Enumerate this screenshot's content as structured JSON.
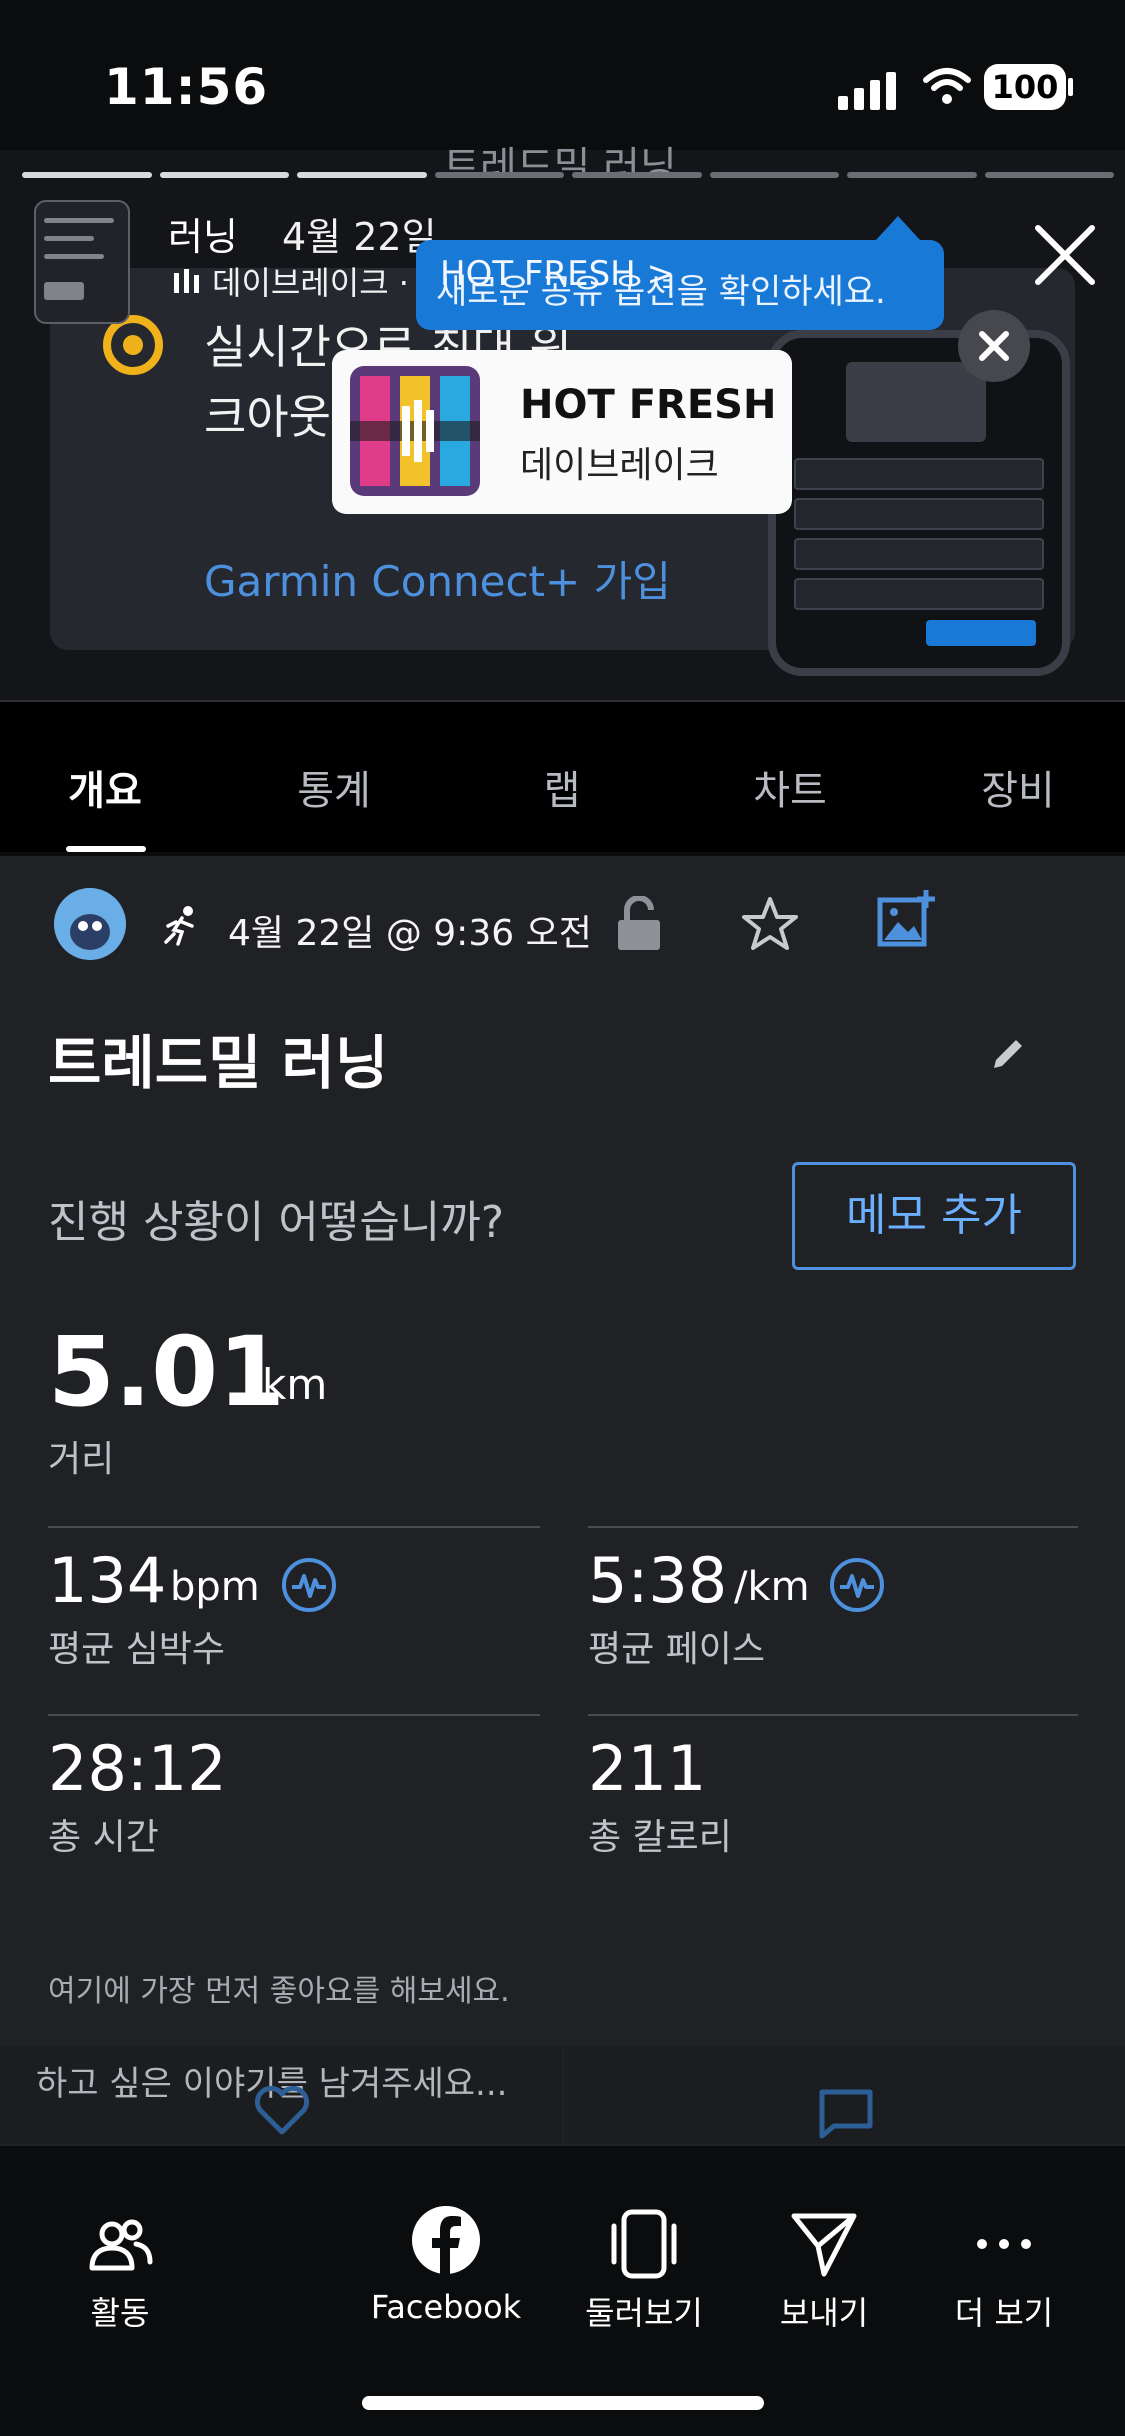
{
  "status_bar": {
    "time": "11:56",
    "battery": "100"
  },
  "story": {
    "header_ghost": "트레드밀 러닝",
    "title": "러닝",
    "date": "4월 22일",
    "artist_line": "데이브레이크 · HOT FRESH >"
  },
  "tooltip": {
    "text": "새로운 공유 옵션을 확인하세요.",
    "overlay": "HOT FRESH >"
  },
  "music": {
    "title": "HOT FRESH",
    "artist": "데이브레이크"
  },
  "promo": {
    "text": "실시간으로 최대 워크아웃 하세요",
    "link": "Garmin Connect+ 가입"
  },
  "tabs": [
    "개요",
    "통계",
    "랩",
    "차트",
    "장비"
  ],
  "activity": {
    "datetime": "4월 22일 @ 9:36 오전",
    "title": "트레드밀 러닝",
    "question": "진행 상황이 어떻습니까?",
    "memo_button": "메모 추가",
    "distance": {
      "value": "5.01",
      "unit": "km",
      "label": "거리"
    },
    "stats": [
      {
        "value": "134",
        "unit": "bpm",
        "label": "평균 심박수"
      },
      {
        "value": "5:38",
        "unit": "/km",
        "label": "평균 페이스"
      },
      {
        "value": "28:12",
        "unit": "",
        "label": "총 시간"
      },
      {
        "value": "211",
        "unit": "",
        "label": "총 칼로리"
      }
    ]
  },
  "social": {
    "like_prompt": "여기에 가장 먼저 좋아요를 해보세요.",
    "comment_placeholder": "하고 싶은 이야기를 남겨주세요..."
  },
  "bottom_nav": [
    {
      "label": "활동",
      "icon": "people-icon"
    },
    {
      "label": "Facebook",
      "icon": "facebook-icon"
    },
    {
      "label": "둘러보기",
      "icon": "phone-icon"
    },
    {
      "label": "보내기",
      "icon": "send-icon"
    },
    {
      "label": "더 보기",
      "icon": "more-icon"
    }
  ]
}
